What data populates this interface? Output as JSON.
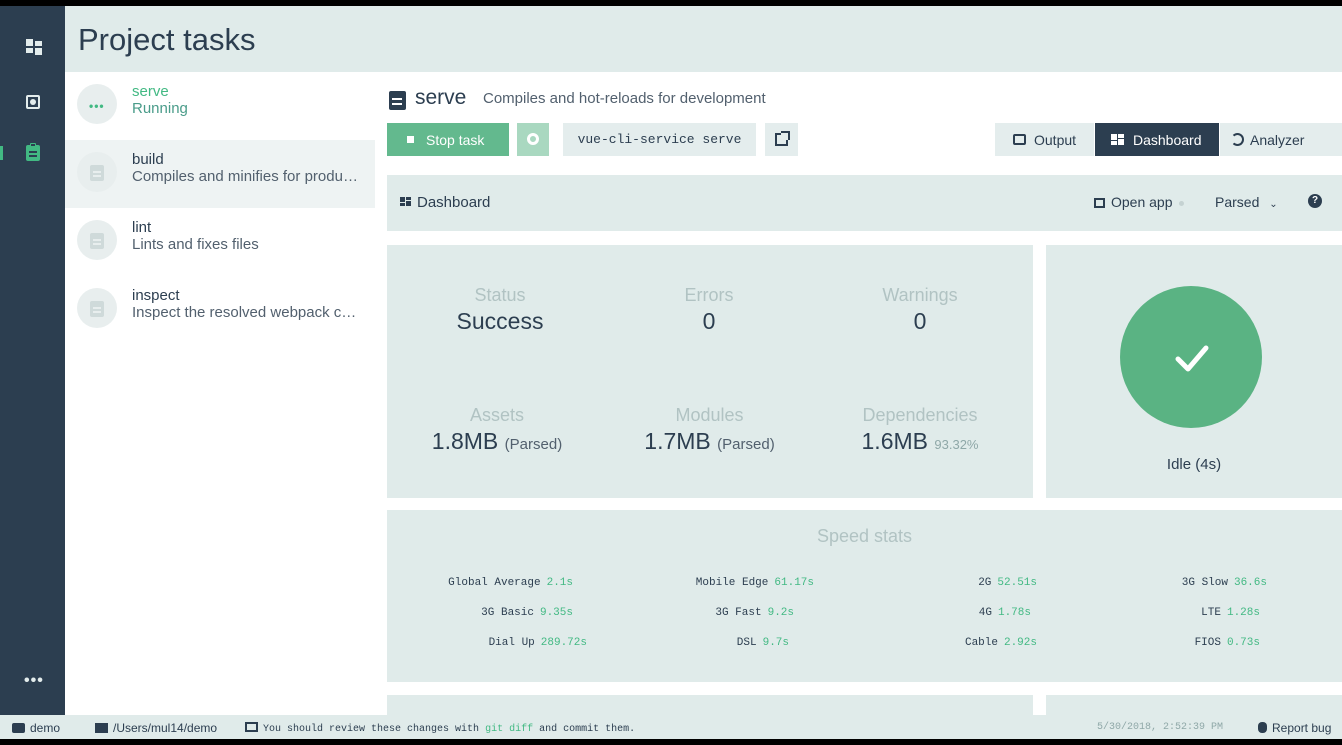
{
  "header": {
    "title": "Project tasks"
  },
  "tasks": [
    {
      "name": "serve",
      "description": "Running",
      "status": "running"
    },
    {
      "name": "build",
      "description": "Compiles and minifies for production"
    },
    {
      "name": "lint",
      "description": "Lints and fixes files"
    },
    {
      "name": "inspect",
      "description": "Inspect the resolved webpack config"
    }
  ],
  "task_header": {
    "name": "serve",
    "description": "Compiles and hot-reloads for development"
  },
  "toolbar": {
    "stop_label": "Stop task",
    "command": "vue-cli-service serve",
    "views": [
      "Output",
      "Dashboard",
      "Analyzer"
    ],
    "active_view": "Dashboard"
  },
  "dashboard": {
    "title": "Dashboard",
    "open_app": "Open app",
    "size_mode": "Parsed",
    "help": "?"
  },
  "stats": {
    "status": {
      "label": "Status",
      "value": "Success"
    },
    "errors": {
      "label": "Errors",
      "value": "0"
    },
    "warnings": {
      "label": "Warnings",
      "value": "0"
    },
    "assets": {
      "label": "Assets",
      "value": "1.8MB",
      "note": "(Parsed)"
    },
    "modules": {
      "label": "Modules",
      "value": "1.7MB",
      "note": "(Parsed)"
    },
    "dependencies": {
      "label": "Dependencies",
      "value": "1.6MB",
      "note": "93.32%"
    }
  },
  "idle": {
    "label": "Idle (4s)"
  },
  "speed": {
    "title": "Speed stats",
    "rows": [
      [
        {
          "name": "Global Average",
          "value": "2.1s"
        },
        {
          "name": "Mobile Edge",
          "value": "61.17s"
        },
        {
          "name": "2G",
          "value": "52.51s"
        },
        {
          "name": "3G Slow",
          "value": "36.6s"
        }
      ],
      [
        {
          "name": "3G Basic",
          "value": "9.35s"
        },
        {
          "name": "3G Fast",
          "value": "9.2s"
        },
        {
          "name": "4G",
          "value": "1.78s"
        },
        {
          "name": "LTE",
          "value": "1.28s"
        }
      ],
      [
        {
          "name": "Dial Up",
          "value": "289.72s"
        },
        {
          "name": "DSL",
          "value": "9.7s"
        },
        {
          "name": "Cable",
          "value": "2.92s"
        },
        {
          "name": "FIOS",
          "value": "0.73s"
        }
      ]
    ]
  },
  "statusbar": {
    "project": "demo",
    "path": "/Users/mul14/demo",
    "message_before": "You should review these changes with",
    "message_code": "git diff",
    "message_after": "and commit them.",
    "timestamp": "5/30/2018, 2:52:39 PM",
    "report": "Report bug"
  },
  "colors": {
    "accent": "#42b983",
    "dark": "#2c3e50",
    "panel": "#e0ebea"
  }
}
